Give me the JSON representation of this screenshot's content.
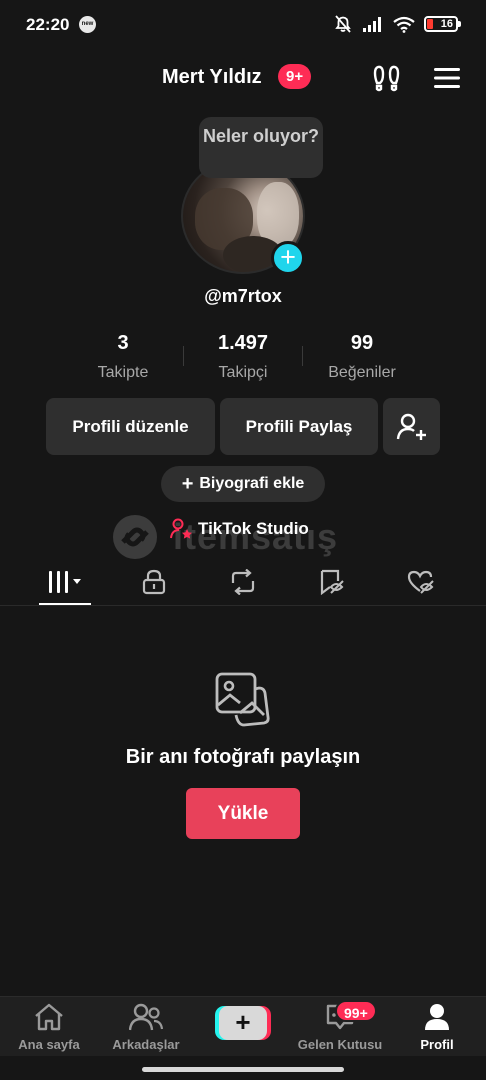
{
  "status_bar": {
    "time": "22:20",
    "dot_label": "new",
    "battery": "16"
  },
  "header": {
    "username": "Mert Yıldız",
    "notification_badge": "9+"
  },
  "tooltip": {
    "text": "Neler oluyor?"
  },
  "profile": {
    "handle": "@m7rtox"
  },
  "stats": [
    {
      "value": "3",
      "label": "Takipte"
    },
    {
      "value": "1.497",
      "label": "Takipçi"
    },
    {
      "value": "99",
      "label": "Beğeniler"
    }
  ],
  "buttons": {
    "edit_profile": "Profili düzenle",
    "share_profile": "Profili Paylaş",
    "add_bio": "Biyografi ekle",
    "tiktok_studio": "TikTok Studio"
  },
  "watermark": {
    "text": "itemsatış"
  },
  "tabs": [
    {
      "icon": "grid-icon",
      "active": true
    },
    {
      "icon": "lock-icon",
      "active": false
    },
    {
      "icon": "repost-icon",
      "active": false
    },
    {
      "icon": "bookmark-hidden-icon",
      "active": false
    },
    {
      "icon": "liked-hidden-icon",
      "active": false
    }
  ],
  "empty_state": {
    "icon": "photo-stack-icon",
    "title": "Bir anı fotoğrafı paylaşın",
    "button": "Yükle"
  },
  "bottom_nav": {
    "items": [
      {
        "label": "Ana sayfa",
        "icon": "home-icon"
      },
      {
        "label": "Arkadaşlar",
        "icon": "friends-icon"
      },
      {
        "label": "",
        "icon": "create-plus-icon"
      },
      {
        "label": "Gelen Kutusu",
        "icon": "inbox-icon"
      },
      {
        "label": "Profil",
        "icon": "profile-icon"
      }
    ],
    "inbox_badge": "99+"
  },
  "colors": {
    "background": "#161616",
    "accent_red": "#fe2c55",
    "accent_cyan": "#20d5ec",
    "upload_button": "#e8415a"
  }
}
